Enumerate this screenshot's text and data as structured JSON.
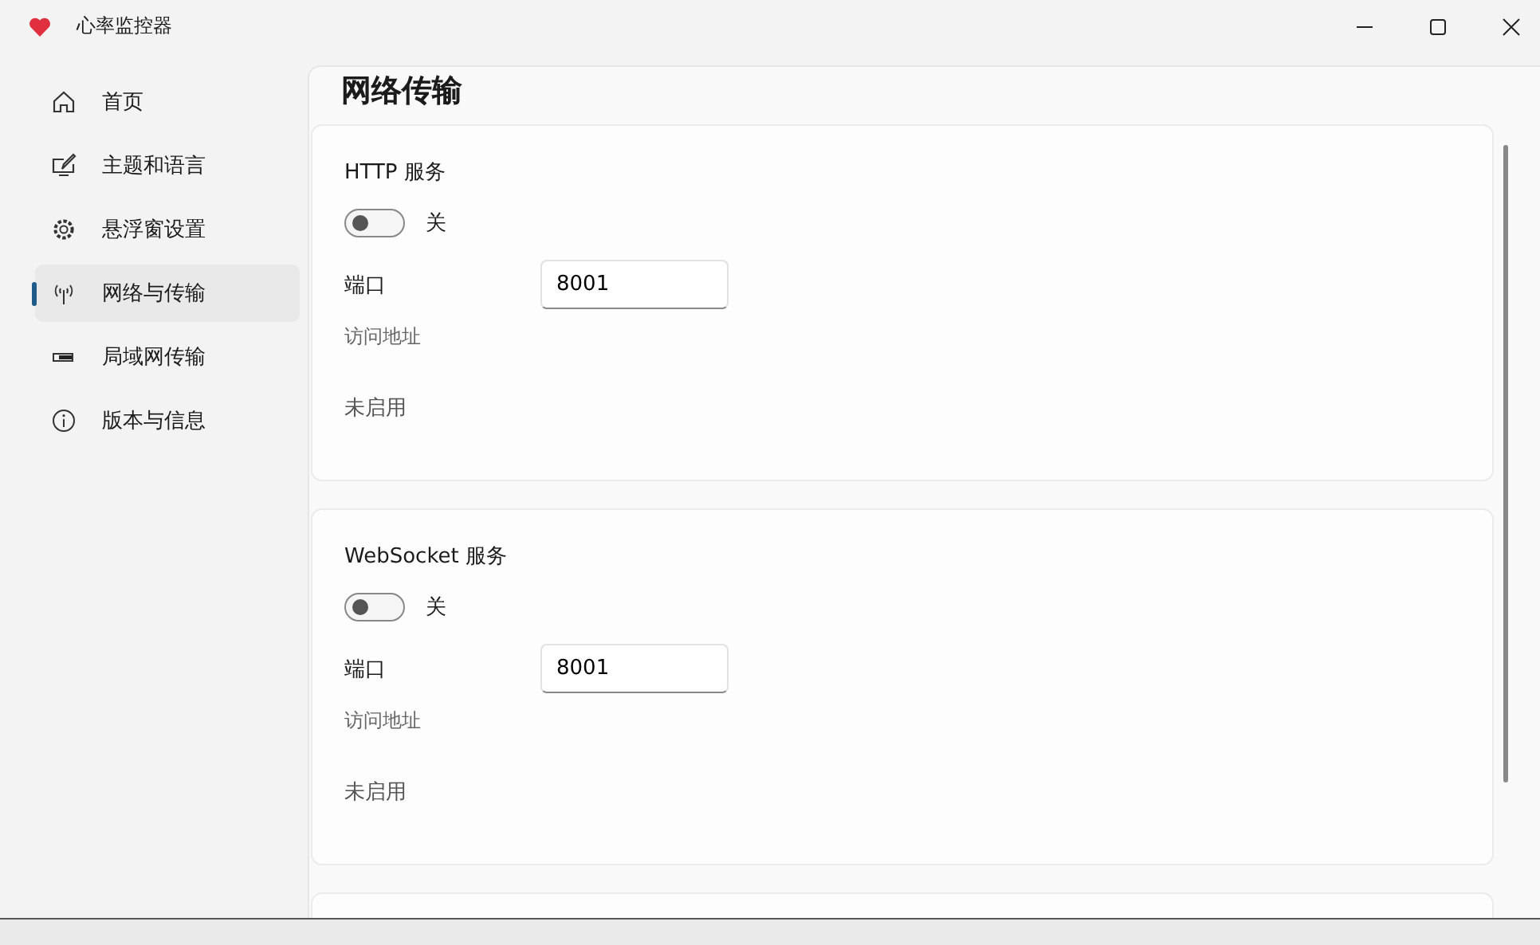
{
  "window": {
    "title": "心率监控器"
  },
  "sidebar": {
    "items": [
      {
        "label": "首页",
        "selected": false
      },
      {
        "label": "主题和语言",
        "selected": false
      },
      {
        "label": "悬浮窗设置",
        "selected": false
      },
      {
        "label": "网络与传输",
        "selected": true
      },
      {
        "label": "局域网传输",
        "selected": false
      },
      {
        "label": "版本与信息",
        "selected": false
      }
    ]
  },
  "page": {
    "title": "网络传输",
    "services": [
      {
        "title": "HTTP 服务",
        "on": false,
        "state_label": "关",
        "port_label": "端口",
        "port": "8001",
        "address_label": "访问地址",
        "status": "未启用"
      },
      {
        "title": "WebSocket 服务",
        "on": false,
        "state_label": "关",
        "port_label": "端口",
        "port": "8001",
        "address_label": "访问地址",
        "status": "未启用"
      }
    ]
  }
}
